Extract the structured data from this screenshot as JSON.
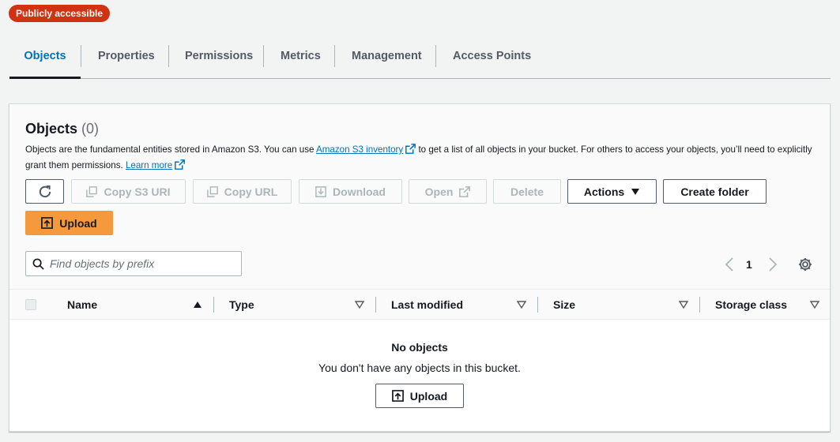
{
  "badge": "Publicly accessible",
  "tabs": [
    "Objects",
    "Properties",
    "Permissions",
    "Metrics",
    "Management",
    "Access Points"
  ],
  "panel": {
    "title": "Objects",
    "count": "(0)",
    "description_pre": "Objects are the fundamental entities stored in Amazon S3. You can use ",
    "inventory_link": "Amazon S3 inventory",
    "description_mid": " to get a list of all objects in your bucket. For others to access your objects, you’ll need to explicitly grant them permissions. ",
    "learn_more": "Learn more"
  },
  "toolbar": {
    "copy_uri": "Copy S3 URI",
    "copy_url": "Copy URL",
    "download": "Download",
    "open": "Open",
    "delete": "Delete",
    "actions": "Actions",
    "create_folder": "Create folder",
    "upload": "Upload"
  },
  "search": {
    "placeholder": "Find objects by prefix"
  },
  "pagination": {
    "current_page": "1"
  },
  "table": {
    "columns": [
      "Name",
      "Type",
      "Last modified",
      "Size",
      "Storage class"
    ],
    "empty_title": "No objects",
    "empty_text": "You don't have any objects in this bucket.",
    "empty_upload": "Upload"
  },
  "icons": [
    "refresh-icon",
    "copy-icon",
    "download-icon",
    "external-link-icon",
    "caret-down-icon",
    "upload-icon",
    "search-icon",
    "chevron-left-icon",
    "chevron-right-icon",
    "gear-icon",
    "sort-asc-icon",
    "sort-icon"
  ],
  "colors": {
    "badge": "#d13212",
    "active_tab": "#0073bb",
    "primary_button": "#f49a3c",
    "link": "#0073bb"
  }
}
